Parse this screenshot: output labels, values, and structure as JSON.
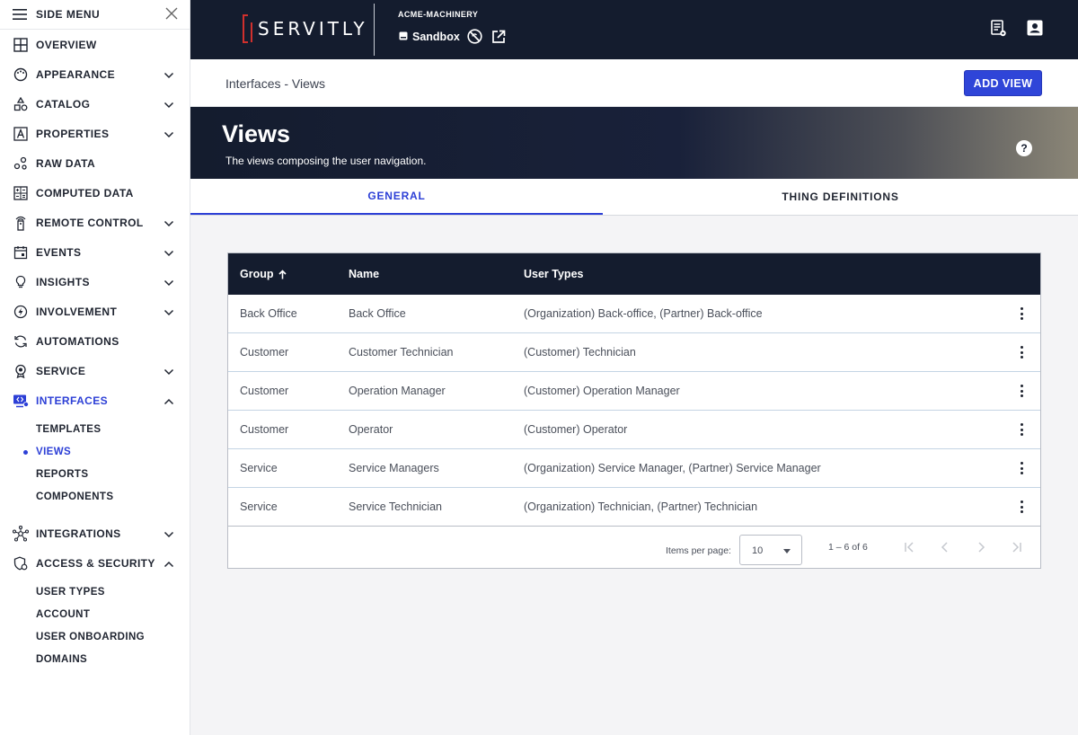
{
  "sidebar": {
    "title": "SIDE MENU",
    "items": [
      {
        "label": "OVERVIEW"
      },
      {
        "label": "APPEARANCE"
      },
      {
        "label": "CATALOG"
      },
      {
        "label": "PROPERTIES"
      },
      {
        "label": "RAW DATA"
      },
      {
        "label": "COMPUTED DATA"
      },
      {
        "label": "REMOTE CONTROL"
      },
      {
        "label": "EVENTS"
      },
      {
        "label": "INSIGHTS"
      },
      {
        "label": "INVOLVEMENT"
      },
      {
        "label": "AUTOMATIONS"
      },
      {
        "label": "SERVICE"
      },
      {
        "label": "INTERFACES"
      },
      {
        "label": "INTEGRATIONS"
      },
      {
        "label": "ACCESS & SECURITY"
      }
    ],
    "interfaces_sub": [
      "TEMPLATES",
      "VIEWS",
      "REPORTS",
      "COMPONENTS"
    ],
    "security_sub": [
      "USER TYPES",
      "ACCOUNT",
      "USER ONBOARDING",
      "DOMAINS"
    ]
  },
  "topbar": {
    "logo": "SERVITLY",
    "org": "ACME-MACHINERY",
    "environment": "Sandbox"
  },
  "pagebar": {
    "breadcrumb": "Interfaces - Views",
    "add_button": "ADD VIEW"
  },
  "hero": {
    "title": "Views",
    "subtitle": "The views composing the user navigation.",
    "help": "?"
  },
  "tabs": [
    "GENERAL",
    "THING DEFINITIONS"
  ],
  "table": {
    "headers": [
      "Group",
      "Name",
      "User Types"
    ],
    "rows": [
      [
        "Back Office",
        "Back Office",
        "(Organization) Back-office, (Partner) Back-office"
      ],
      [
        "Customer",
        "Customer Technician",
        "(Customer) Technician"
      ],
      [
        "Customer",
        "Operation Manager",
        "(Customer) Operation Manager"
      ],
      [
        "Customer",
        "Operator",
        "(Customer) Operator"
      ],
      [
        "Service",
        "Service Managers",
        "(Organization) Service Manager, (Partner) Service Manager"
      ],
      [
        "Service",
        "Service Technician",
        "(Organization) Technician, (Partner) Technician"
      ]
    ],
    "items_per_page_label": "Items per page:",
    "items_per_page": "10",
    "range": "1 – 6 of 6"
  },
  "colors": {
    "navy": "#141c2e",
    "accent": "#2c3fd6",
    "logo_red": "#d0302d"
  }
}
